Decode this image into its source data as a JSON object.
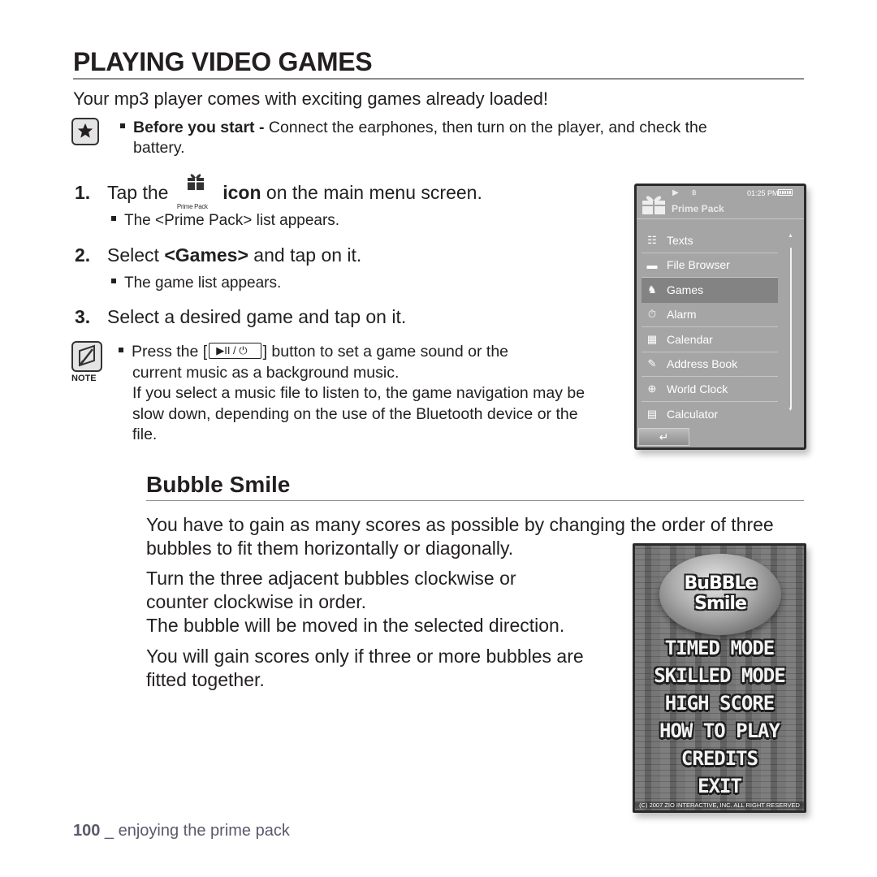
{
  "page": {
    "title": "PLAYING VIDEO GAMES",
    "intro": "Your mp3 player comes with exciting games already loaded!",
    "before_start": {
      "icon": "star-icon",
      "bold": "Before you start -",
      "text": " Connect the earphones, then turn on the player, and check the",
      "text_cont": "battery."
    },
    "steps": [
      {
        "number": "1.",
        "pre": "Tap the",
        "icon_label": "Prime Pack",
        "bold": "icon",
        "post": " on the main menu screen.",
        "sub": "The <Prime Pack> list appears."
      },
      {
        "number": "2.",
        "pre": "Select ",
        "bold": "<Games>",
        "post": " and tap on it.",
        "sub": "The game list appears."
      },
      {
        "number": "3.",
        "text": "Select a desired game and tap on it."
      }
    ],
    "note": {
      "label": "NOTE",
      "pre": "Press the [",
      "button_glyph": "▶II / ⏻",
      "post": "] button to set a game sound or the",
      "line2": "current music as a background music.",
      "para": "If you select a music file to listen to, the game navigation may be slow down, depending on the use of the Bluetooth device or the file."
    },
    "section": {
      "title": "Bubble Smile",
      "p1": "You have to gain as many scores as possible by changing the order of three bubbles to fit them horizontally or diagonally.",
      "p2": "Turn the three adjacent bubbles clockwise or counter clockwise in order.",
      "p3": "The bubble will be moved in the selected direction.",
      "p4": "You will gain scores only if three or more bubbles are fitted together."
    },
    "footer": {
      "page_number": "100",
      "text": " _ enjoying the prime pack"
    }
  },
  "device_screen": {
    "status": {
      "play": "▶",
      "bt": "฿",
      "time": "01:25 PM"
    },
    "title": "Prime Pack",
    "items": [
      {
        "label": "Texts",
        "icon": "document-icon",
        "glyph": "☷"
      },
      {
        "label": "File Browser",
        "icon": "folder-icon",
        "glyph": "▬"
      },
      {
        "label": "Games",
        "icon": "gamepad-icon",
        "glyph": "♞",
        "selected": true
      },
      {
        "label": "Alarm",
        "icon": "stopwatch-icon",
        "glyph": "⏱"
      },
      {
        "label": "Calendar",
        "icon": "calendar-icon",
        "glyph": "▦"
      },
      {
        "label": "Address Book",
        "icon": "address-book-icon",
        "glyph": "✎"
      },
      {
        "label": "World Clock",
        "icon": "globe-icon",
        "glyph": "⊕"
      },
      {
        "label": "Calculator",
        "icon": "calculator-icon",
        "glyph": "▤"
      }
    ],
    "back_glyph": "↵"
  },
  "game_screen": {
    "logo_line1": "BuBBLe",
    "logo_line2": "Smile",
    "menu": [
      "TIMED MODE",
      "SKILLED MODE",
      "HIGH SCORE",
      "HOW TO PLAY",
      "CREDITS",
      "EXIT"
    ],
    "copyright": "(C) 2007 ZIO INTERACTIVE, INC. ALL RIGHT RESERVED"
  }
}
